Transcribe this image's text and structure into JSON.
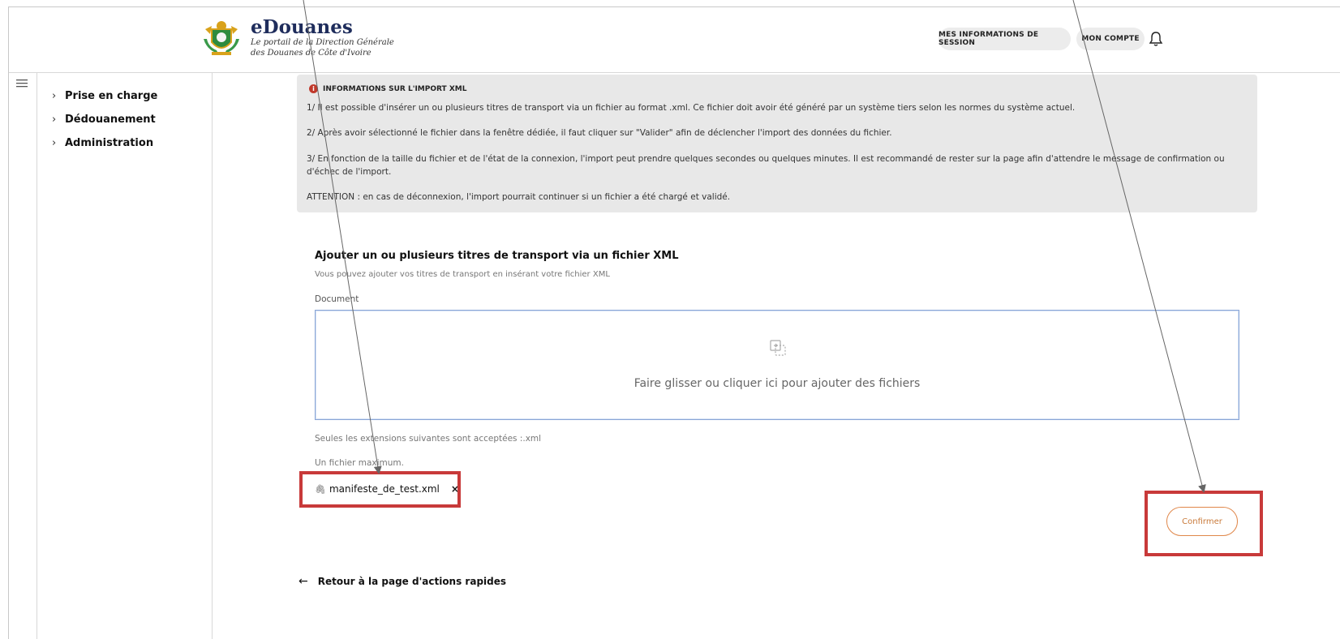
{
  "header": {
    "brand_title": "eDouanes",
    "brand_subtitle_line1": "Le portail de la Direction Générale",
    "brand_subtitle_line2": "des Douanes de Côte d'Ivoire",
    "session_button": "MES INFORMATIONS DE SESSION",
    "account_button": "MON COMPTE",
    "bell_icon": "bell-icon"
  },
  "sidebar": {
    "menu_icon": "hamburger-icon",
    "items": [
      {
        "label": "Prise en charge"
      },
      {
        "label": "Dédouanement"
      },
      {
        "label": "Administration"
      }
    ]
  },
  "info": {
    "title": "INFORMATIONS SUR L'IMPORT XML",
    "p1": "1/ Il est possible d'insérer un ou plusieurs titres de transport via un fichier au format .xml. Ce fichier doit avoir été généré par un système tiers selon les normes du système actuel.",
    "p2": "2/ Après avoir sélectionné le fichier dans la fenêtre dédiée, il faut cliquer sur \"Valider\" afin de déclencher l'import des données du fichier.",
    "p3": "3/ En fonction de la taille du fichier et de l'état de la connexion, l'import peut prendre quelques secondes ou quelques minutes. Il est recommandé de rester sur la page afin d'attendre le message de confirmation ou d'échec de l'import.",
    "p4": "ATTENTION : en cas de déconnexion, l'import pourrait continuer si un fichier a été chargé et validé."
  },
  "upload": {
    "title": "Ajouter un ou plusieurs titres de transport via un fichier XML",
    "subtitle": "Vous pouvez ajouter vos titres de transport en insérant votre fichier XML",
    "document_label": "Document",
    "dropzone_text": "Faire glisser ou cliquer ici pour ajouter des fichiers",
    "extensions_note": "Seules les extensions suivantes sont acceptées :.xml",
    "max_note": "Un fichier maximum.",
    "file_name": "manifeste_de_test.xml",
    "remove_symbol": "×",
    "confirm_label": "Confirmer"
  },
  "back_link": {
    "arrow": "←",
    "label": "Retour à la page d'actions rapides"
  },
  "colors": {
    "highlight": "#c83a3a",
    "confirm_border": "#e0874a",
    "info_bg": "#e8e8e8",
    "dropzone_border": "#8aa6d6"
  }
}
